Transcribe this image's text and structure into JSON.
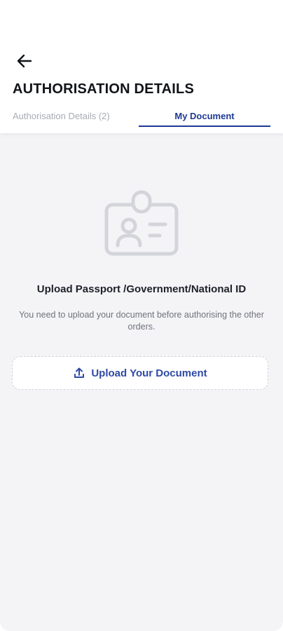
{
  "header": {
    "title": "AUTHORISATION DETAILS",
    "back_icon": "arrow-left-icon"
  },
  "tabs": [
    {
      "label": "Authorisation Details (2)",
      "active": false
    },
    {
      "label": "My Document",
      "active": true
    }
  ],
  "empty_state": {
    "icon": "id-card-icon",
    "title": "Upload Passport /Government/National ID",
    "description": "You need to upload your document before authorising the other orders."
  },
  "upload_button": {
    "label": "Upload Your Document",
    "icon": "upload-icon"
  },
  "colors": {
    "accent": "#1f3a93",
    "button_text": "#2e4aa6",
    "background": "#f4f4f7",
    "inactive_tab": "#a7abb3",
    "icon_gray": "#d3d5da"
  }
}
